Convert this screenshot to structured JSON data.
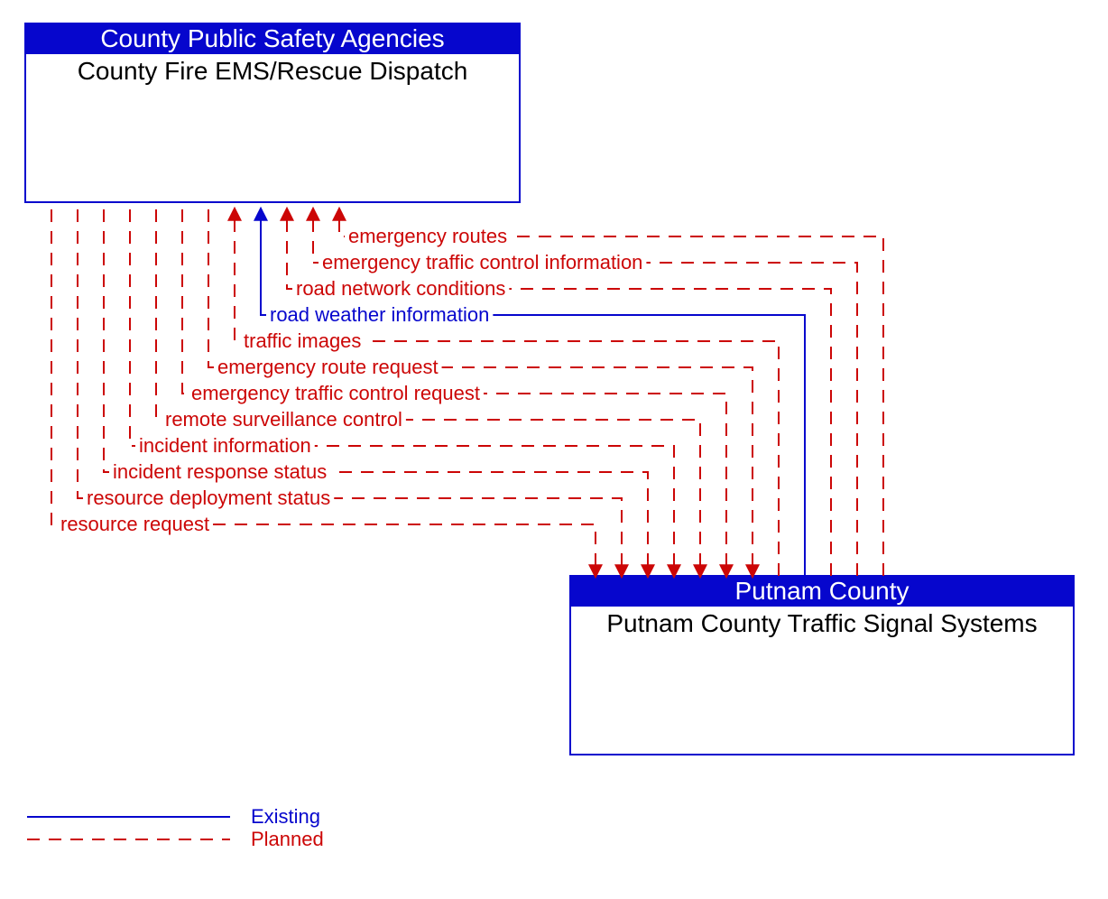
{
  "colors": {
    "blue": "#0606cd",
    "red": "#cc0606"
  },
  "topBox": {
    "header": "County Public Safety Agencies",
    "body": "County Fire EMS/Rescue Dispatch"
  },
  "bottomBox": {
    "header": "Putnam County",
    "body": "Putnam County Traffic Signal Systems"
  },
  "legend": {
    "existing": "Existing",
    "planned": "Planned"
  },
  "flows": [
    {
      "label": "emergency routes",
      "status": "planned",
      "to": "top"
    },
    {
      "label": "emergency traffic control information",
      "status": "planned",
      "to": "top"
    },
    {
      "label": "road network conditions",
      "status": "planned",
      "to": "top"
    },
    {
      "label": "road weather information",
      "status": "existing",
      "to": "top"
    },
    {
      "label": "traffic images",
      "status": "planned",
      "to": "top"
    },
    {
      "label": "emergency route request",
      "status": "planned",
      "to": "bottom"
    },
    {
      "label": "emergency traffic control request",
      "status": "planned",
      "to": "bottom"
    },
    {
      "label": "remote surveillance control",
      "status": "planned",
      "to": "bottom"
    },
    {
      "label": "incident information",
      "status": "planned",
      "to": "bottom"
    },
    {
      "label": "incident response status",
      "status": "planned",
      "to": "bottom"
    },
    {
      "label": "resource deployment status",
      "status": "planned",
      "to": "bottom"
    },
    {
      "label": "resource request",
      "status": "planned",
      "to": "bottom"
    }
  ]
}
